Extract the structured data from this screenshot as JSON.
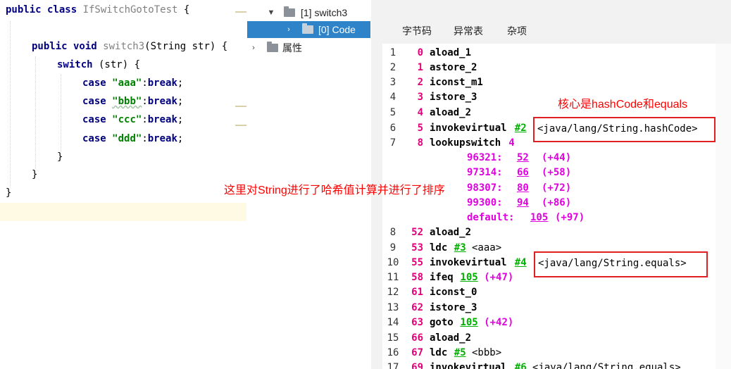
{
  "editor": {
    "lines": [
      {
        "parts": [
          {
            "t": "public class ",
            "c": "kw"
          },
          {
            "t": "IfSwitchGotoTest",
            "c": "gray"
          },
          {
            "t": " {",
            "c": ""
          }
        ]
      },
      {
        "parts": [
          {
            "t": "public void ",
            "c": "kw"
          },
          {
            "t": "switch3",
            "c": "gray"
          },
          {
            "t": "(String str) {",
            "c": ""
          }
        ]
      },
      {
        "parts": [
          {
            "t": "switch",
            "c": "kw"
          },
          {
            "t": " (str) {",
            "c": ""
          }
        ]
      },
      {
        "parts": [
          {
            "t": "case ",
            "c": "kw"
          },
          {
            "t": "\"aaa\"",
            "c": "str"
          },
          {
            "t": ":",
            "c": ""
          },
          {
            "t": "break",
            "c": "kw"
          },
          {
            "t": ";",
            "c": ""
          }
        ]
      },
      {
        "parts": [
          {
            "t": "case ",
            "c": "kw"
          },
          {
            "t": "\"bbb\"",
            "c": "str squig"
          },
          {
            "t": ":",
            "c": ""
          },
          {
            "t": "break",
            "c": "kw"
          },
          {
            "t": ";",
            "c": ""
          }
        ]
      },
      {
        "parts": [
          {
            "t": "case ",
            "c": "kw"
          },
          {
            "t": "\"ccc\"",
            "c": "str"
          },
          {
            "t": ":",
            "c": ""
          },
          {
            "t": "break",
            "c": "kw"
          },
          {
            "t": ";",
            "c": ""
          }
        ]
      },
      {
        "parts": [
          {
            "t": "case ",
            "c": "kw"
          },
          {
            "t": "\"ddd\"",
            "c": "str"
          },
          {
            "t": ":",
            "c": ""
          },
          {
            "t": "break",
            "c": "kw"
          },
          {
            "t": ";",
            "c": ""
          }
        ]
      },
      {
        "parts": [
          {
            "t": "}",
            "c": ""
          }
        ]
      },
      {
        "parts": [
          {
            "t": "}",
            "c": ""
          }
        ]
      },
      {
        "parts": [
          {
            "t": "}",
            "c": ""
          }
        ]
      }
    ]
  },
  "tree": {
    "items": [
      {
        "label": "[1] switch3",
        "expanded": true,
        "selected": false
      },
      {
        "label": "[0] Code",
        "expanded": false,
        "selected": true
      },
      {
        "label": "属性",
        "expanded": false,
        "selected": false
      }
    ]
  },
  "bytecode": {
    "tabs": [
      "字节码",
      "异常表",
      "杂项"
    ],
    "lines": [
      {
        "ln": "1",
        "pc": "0",
        "op": "aload_1"
      },
      {
        "ln": "2",
        "pc": "1",
        "op": "astore_2"
      },
      {
        "ln": "3",
        "pc": "2",
        "op": "iconst_m1"
      },
      {
        "ln": "4",
        "pc": "3",
        "op": "istore_3"
      },
      {
        "ln": "5",
        "pc": "4",
        "op": "aload_2"
      },
      {
        "ln": "6",
        "pc": "5",
        "op": "invokevirtual",
        "ref": "#2",
        "extra": ""
      },
      {
        "ln": "7",
        "pc": "8",
        "op": "lookupswitch",
        "num": "4"
      },
      {
        "case": "96321:",
        "target": "52",
        "off": "(+44)"
      },
      {
        "case": "97314:",
        "target": "66",
        "off": "(+58)"
      },
      {
        "case": "98307:",
        "target": "80",
        "off": "(+72)"
      },
      {
        "case": "99300:",
        "target": "94",
        "off": "(+86)"
      },
      {
        "case": "default:",
        "target": "105",
        "off": "(+97)"
      },
      {
        "ln": "8",
        "pc": "52",
        "op": "aload_2"
      },
      {
        "ln": "9",
        "pc": "53",
        "op": "ldc",
        "ref": "#3",
        "extra": "<aaa>"
      },
      {
        "ln": "10",
        "pc": "55",
        "op": "invokevirtual",
        "ref": "#4",
        "extra": ""
      },
      {
        "ln": "11",
        "pc": "58",
        "op": "ifeq",
        "ref": "105",
        "off": "(+47)"
      },
      {
        "ln": "12",
        "pc": "61",
        "op": "iconst_0"
      },
      {
        "ln": "13",
        "pc": "62",
        "op": "istore_3"
      },
      {
        "ln": "14",
        "pc": "63",
        "op": "goto",
        "ref": "105",
        "off": "(+42)"
      },
      {
        "ln": "15",
        "pc": "66",
        "op": "aload_2"
      },
      {
        "ln": "16",
        "pc": "67",
        "op": "ldc",
        "ref": "#5",
        "extra": "<bbb>"
      },
      {
        "ln": "17",
        "pc": "69",
        "op": "invokevirtual",
        "ref": "#6",
        "extra": "<java/lang/String.equals>"
      }
    ]
  },
  "annotations": {
    "note_hash": "核心是hashCode和equals",
    "note_sort": "这里对String进行了哈希值计算并进行了排序",
    "box_hashcode": "<java/lang/String.hashCode>",
    "box_equals": "<java/lang/String.equals>"
  },
  "colors": {
    "selection": "#2f83c8",
    "annotation": "#ff0000",
    "keyword": "#000080",
    "string": "#008000",
    "pc": "#e0007a",
    "ref": "#00b000",
    "case": "#e000e0"
  }
}
